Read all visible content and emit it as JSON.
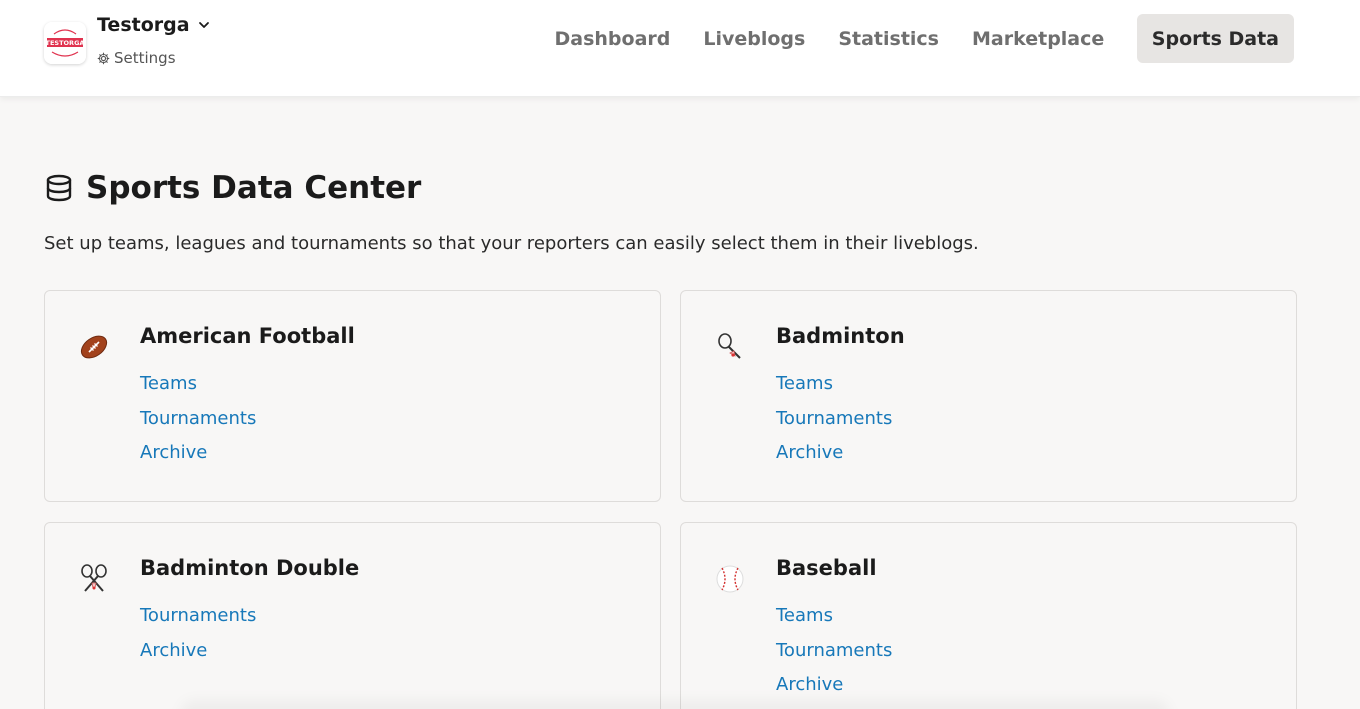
{
  "org": {
    "name": "Testorga",
    "logo_text": "TESTORGA",
    "settings_label": "Settings"
  },
  "nav": {
    "items": [
      {
        "label": "Dashboard",
        "active": false
      },
      {
        "label": "Liveblogs",
        "active": false
      },
      {
        "label": "Statistics",
        "active": false
      },
      {
        "label": "Marketplace",
        "active": false
      },
      {
        "label": "Sports Data",
        "active": true
      }
    ]
  },
  "page": {
    "title": "Sports Data Center",
    "title_icon": "database-icon",
    "description": "Set up teams, leagues and tournaments so that your reporters can easily select them in their liveblogs."
  },
  "sports": [
    {
      "name": "American Football",
      "icon": "american-football-icon",
      "links": [
        "Teams",
        "Tournaments",
        "Archive"
      ]
    },
    {
      "name": "Badminton",
      "icon": "badminton-icon",
      "links": [
        "Teams",
        "Tournaments",
        "Archive"
      ]
    },
    {
      "name": "Badminton Double",
      "icon": "badminton-double-icon",
      "links": [
        "Tournaments",
        "Archive"
      ]
    },
    {
      "name": "Baseball",
      "icon": "baseball-icon",
      "links": [
        "Teams",
        "Tournaments",
        "Archive"
      ]
    }
  ],
  "colors": {
    "link": "#1778b9",
    "background": "#f8f7f6",
    "active_nav_bg": "#e7e5e3",
    "logo_red": "#e0334f"
  }
}
